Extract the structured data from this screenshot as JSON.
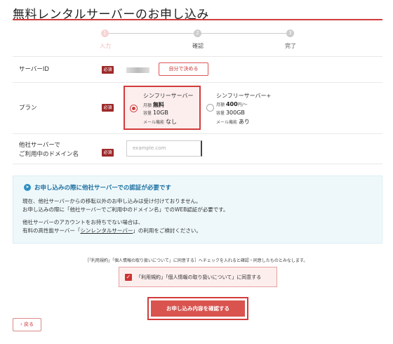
{
  "page": {
    "title": "無料レンタルサーバーのお申し込み"
  },
  "steps": [
    {
      "number": "1",
      "label": "入力"
    },
    {
      "number": "2",
      "label": "確認"
    },
    {
      "number": "3",
      "label": "完了"
    }
  ],
  "form": {
    "required_badge": "必須",
    "server_id": {
      "label": "サーバーID",
      "auto_button": "自分で決める"
    },
    "plan": {
      "label": "プラン",
      "options": [
        {
          "name": "シンフリーサーバー",
          "fee_label": "月額",
          "fee": "無料",
          "capacity_label": "容量",
          "capacity": "10GB",
          "mail_label": "メール機能",
          "mail": "なし",
          "selected": true
        },
        {
          "name": "シンフリーサーバー+",
          "fee_label": "月額",
          "fee": "400",
          "fee_unit": "円/～",
          "capacity_label": "容量",
          "capacity": "300GB",
          "mail_label": "メール機能",
          "mail": "あり",
          "selected": false
        }
      ]
    },
    "domain": {
      "label_line1": "他社サーバーで",
      "label_line2": "ご利用中のドメイン名",
      "placeholder": "example.com"
    }
  },
  "notice": {
    "title": "お申し込みの際に他社サーバーでの認証が必要です",
    "line1": "現在、他社サーバーからの移転以外のお申し込みは受け付けておりません。",
    "line2": "お申し込みの際に「他社サーバーでご利用中のドメイン名」でのWEB認証が必要です。",
    "line3": "他社サーバーのアカウントをお持ちでない場合は、",
    "line4_prefix": "有料の高性能サーバー「",
    "line4_link": "シンレンタルサーバー",
    "line4_suffix": "」の利用をご検討ください。"
  },
  "agreement": {
    "line": "［「利用規約」「個人情報の取り扱いについて」に同意する］へチェックを入れると確認・同意したものとみなします。",
    "checkbox_label": "「利用規約」「個人情報の取り扱いについて」に同意する",
    "checked": true
  },
  "actions": {
    "submit": "お申し込み内容を確認する",
    "back": "戻る"
  }
}
